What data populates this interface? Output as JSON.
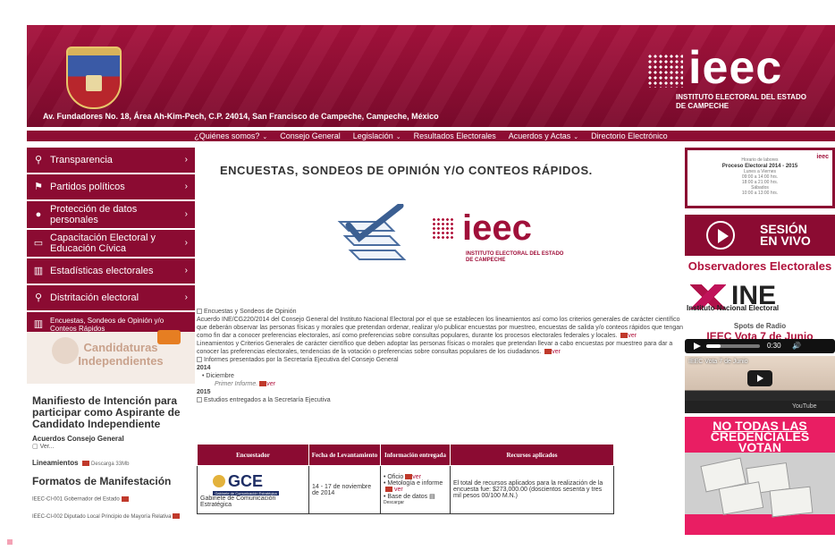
{
  "header": {
    "address": "Av. Fundadores No. 18, Área Ah-Kim-Pech, C.P. 24014, San Francisco de Campeche, Campeche, México",
    "logo_text": "ieec",
    "logo_sub": "INSTITUTO ELECTORAL DEL ESTADO DE CAMPECHE",
    "brand_color": "#8b0b32"
  },
  "nav": {
    "items": [
      "¿Quiénes somos?",
      "Consejo General",
      "Legislación",
      "Resultados Electorales",
      "Acuerdos y Actas",
      "Directorio Electrónico"
    ]
  },
  "sidebar": {
    "items": [
      {
        "label": "Transparencia",
        "icon": "search-icon"
      },
      {
        "label": "Partidos políticos",
        "icon": "flag-icon"
      },
      {
        "label": "Protección de datos personales",
        "icon": "shield-icon"
      },
      {
        "label": "Capacitación Electoral y Educación Cívica",
        "icon": "book-icon"
      },
      {
        "label": "Estadísticas electorales",
        "icon": "bar-chart-icon"
      },
      {
        "label": "Distritación electoral",
        "icon": "map-pin-icon"
      },
      {
        "label": "Encuestas, Sondeos de Opinión y/o Conteos Rápidos",
        "icon": "bar-chart-icon"
      }
    ],
    "candidaturas": "Candidaturas Independientes",
    "manifest": "Manifiesto de Intención para participar como Aspirante de Candidato Independiente",
    "acuerdos": "Acuerdos Consejo General",
    "ver": "Ver...",
    "lineamientos_label": "Lineamientos",
    "lineamientos_size": "Descarga 33Mb",
    "formatos": "Formatos de Manifestación",
    "doc1": "IEEC-CI-001 Gobernador del Estado",
    "doc2": "IEEC-CI-002 Diputado Local Principio de Mayoría Relativa"
  },
  "main": {
    "title": "ENCUESTAS, SONDEOS DE OPINIÓN Y/O CONTEOS RÁPIDOS.",
    "center_logo": "ieec",
    "center_logo_sub": "INSTITUTO ELECTORAL DEL ESTADO DE CAMPECHE",
    "section_label": "Encuestas y Sondeos de Opinión",
    "para1": "Acuerdo INE/CG220/2014 del Consejo General del Instituto Nacional Electoral por el que se establecen los lineamientos así como los criterios generales de carácter científico que deberán observar las personas físicas y morales que pretendan ordenar, realizar y/o publicar encuestas por muestreo, encuestas de salida y/o conteos rápidos que tengan como fin dar a conocer preferencias electorales, así como preferencias sobre consultas populares, durante los procesos electorales federales y locales.",
    "ver": "ver",
    "para2": "Lineamientos y Criterios Generales de carácter científico que deben adoptar las personas físicas o morales que pretendan llevar a cabo encuestas por muestreo para dar a conocer las preferencias electorales, tendencias de la votación o preferencias sobre consultas populares de los ciudadanos.",
    "informes": "Informes presentados por la Secretaría Ejecutiva del Consejo General",
    "year1": "2014",
    "month": "• Diciembre",
    "primer": "Primer Informe.",
    "year2": "2015",
    "estudios": "Estudios entregados a la Secretaría Ejecutiva"
  },
  "table": {
    "headers": [
      "Encuestador",
      "Fecha de Levantamiento",
      "Información entregada",
      "Recursos aplicados"
    ],
    "row": {
      "encuestador_logo": "GCE",
      "encuestador_logo_sub": "Gabinete de Comunicación Estratégica",
      "encuestador": "Gabinete de Comunicación Estratégica",
      "fecha": "14 - 17 de noviembre de 2014",
      "info1": "• Oficio",
      "info2": "• Metología e informe",
      "info3": "• Base de datos",
      "descargar": "Descargar",
      "recursos": "El total de recursos aplicados para la realización de la encuesta fue: $273,000.00 (doscientos sesenta y tres mil pesos 00/100 M.N.)"
    }
  },
  "right": {
    "horario_title": "Proceso Electoral 2014 - 2015",
    "horario_top": "Horario de labores",
    "horario_lines": [
      "Lunes a Viernes",
      "09:00 a 14:00 hrs.",
      "18:00 a 21:00 hrs.",
      "Sábados",
      "10:00 a 13:00 hrs."
    ],
    "sesion": "SESIÓN EN VIVO",
    "observadores": "Observadores Electorales",
    "ine": "INE",
    "ine_sub": "Instituto Nacional Electoral",
    "spots": "Spots de Radio",
    "radio_title": "IEEC Vota 7 de Junio",
    "audio_time": "0:30",
    "video_title": "IEEC Vota 7 de Junio",
    "video_brand": "YouTube",
    "cred_line1": "NO TODAS LAS",
    "cred_line2": "CREDENCIALES",
    "cred_line3": "VOTAN"
  }
}
